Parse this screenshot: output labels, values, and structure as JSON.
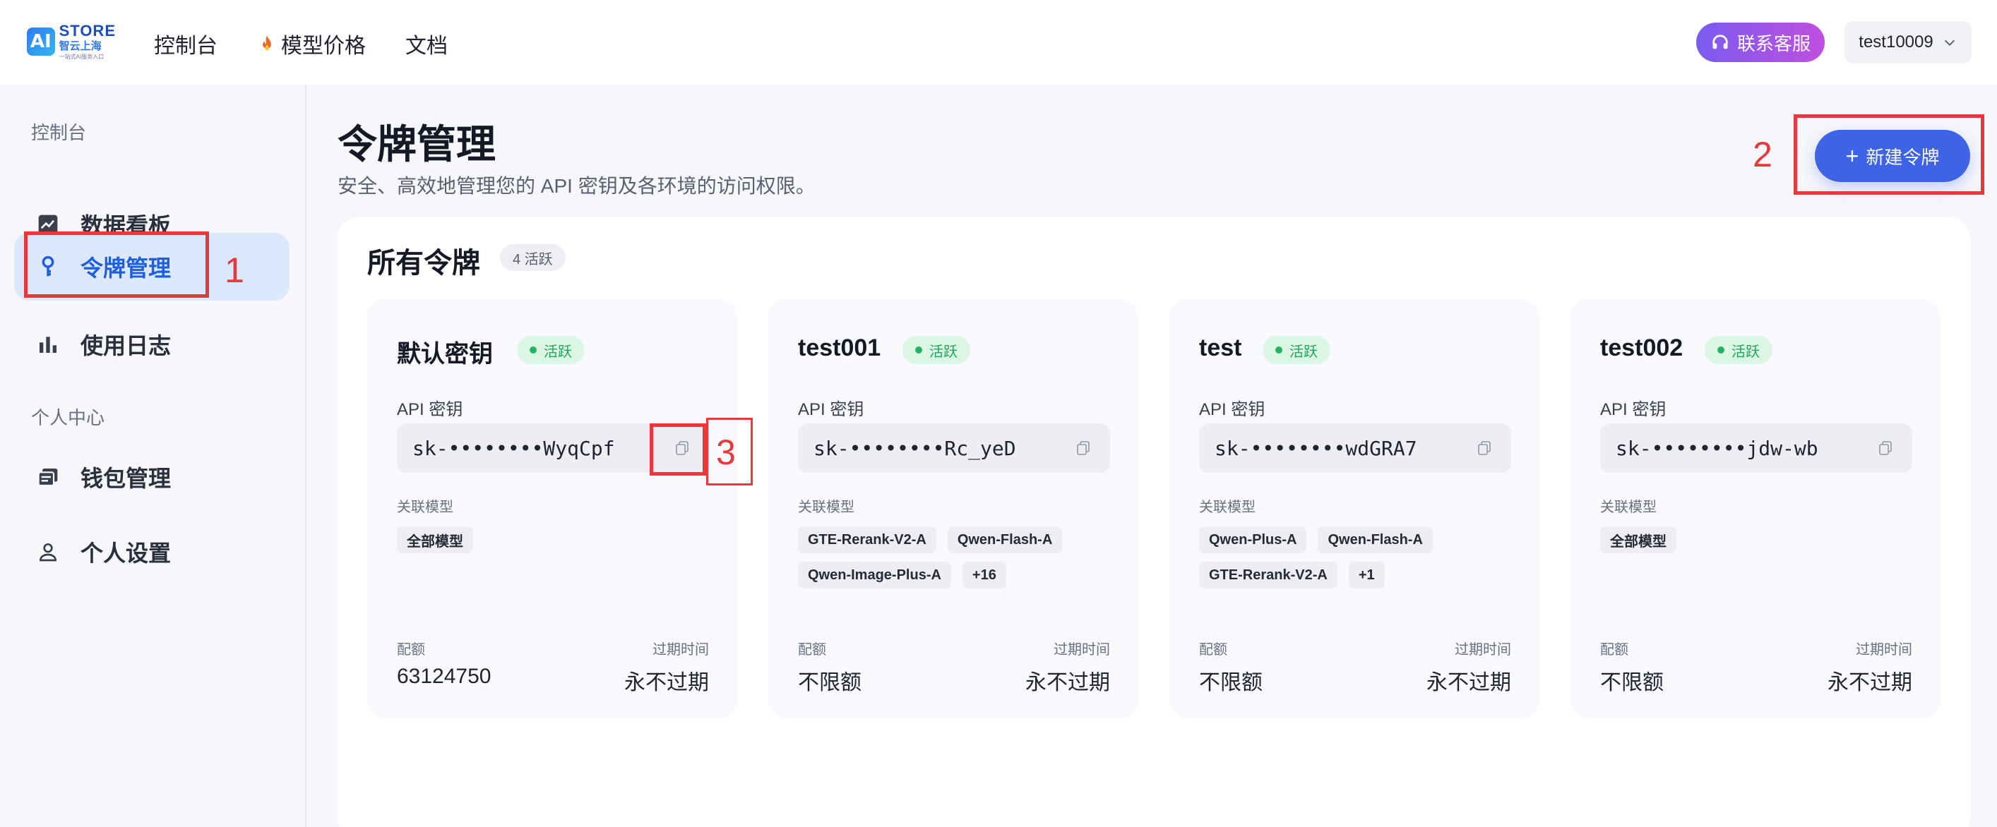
{
  "brand": {
    "mark": "AI",
    "name": "STORE",
    "sub": "智云上海",
    "tagline": "一站式AI服务入口"
  },
  "topnav": [
    {
      "label": "控制台",
      "icon": ""
    },
    {
      "label": "模型价格",
      "icon": "fire-icon"
    },
    {
      "label": "文档",
      "icon": ""
    }
  ],
  "header": {
    "support_label": "联系客服",
    "username": "test10009"
  },
  "sidebar": {
    "group1": "控制台",
    "group2": "个人中心",
    "items": [
      {
        "label": "数据看板",
        "icon": "trend-chart-icon"
      },
      {
        "label": "令牌管理",
        "icon": "key-icon"
      },
      {
        "label": "使用日志",
        "icon": "bar-chart-icon"
      },
      {
        "label": "钱包管理",
        "icon": "wallet-icon"
      },
      {
        "label": "个人设置",
        "icon": "user-icon"
      }
    ]
  },
  "page": {
    "title": "令牌管理",
    "description": "安全、高效地管理您的 API 密钥及各环境的访问权限。",
    "new_button": "新建令牌"
  },
  "panel": {
    "title": "所有令牌",
    "count_badge": "4 活跃"
  },
  "annotations": [
    "1",
    "2",
    "3"
  ],
  "labels": {
    "api_key": "API 密钥",
    "models": "关联模型",
    "quota": "配额",
    "expire": "过期时间"
  },
  "cards": [
    {
      "name": "默认密钥",
      "status": "活跃",
      "key": "sk-••••••••WyqCpf",
      "models": [
        "全部模型"
      ],
      "quota": "63124750",
      "expire": "永不过期"
    },
    {
      "name": "test001",
      "status": "活跃",
      "key": "sk-••••••••Rc_yeD",
      "models": [
        "GTE-Rerank-V2-A",
        "Qwen-Flash-A",
        "Qwen-Image-Plus-A",
        "+16"
      ],
      "quota": "不限额",
      "expire": "永不过期"
    },
    {
      "name": "test",
      "status": "活跃",
      "key": "sk-••••••••wdGRA7",
      "models": [
        "Qwen-Plus-A",
        "Qwen-Flash-A",
        "GTE-Rerank-V2-A",
        "+1"
      ],
      "quota": "不限额",
      "expire": "永不过期"
    },
    {
      "name": "test002",
      "status": "活跃",
      "key": "sk-••••••••jdw-wb",
      "models": [
        "全部模型"
      ],
      "quota": "不限额",
      "expire": "永不过期"
    }
  ],
  "colors": {
    "accent": "#3e63e6",
    "active_bg": "#dce8fb",
    "active_text": "#1d5fe0",
    "status_green": "#22a559",
    "annotation_red": "#e8383d"
  }
}
